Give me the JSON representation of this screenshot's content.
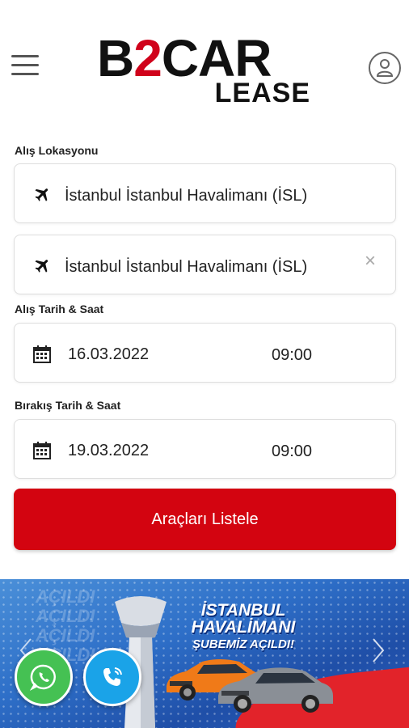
{
  "header": {
    "logo_main_left": "B",
    "logo_main_two": "2",
    "logo_main_right": "CAR",
    "logo_sub": "LEASE",
    "menu_icon": "hamburger-menu-icon",
    "user_icon": "user-account-icon"
  },
  "pickup": {
    "label": "Alış Lokasyonu",
    "location": "İstanbul İstanbul Havalimanı (İSL)",
    "icon": "plane-icon"
  },
  "dropoff": {
    "location": "İstanbul İstanbul Havalimanı (İSL)",
    "clear": "×",
    "icon": "plane-icon"
  },
  "pickup_datetime": {
    "label": "Alış Tarih & Saat",
    "date": "16.03.2022",
    "time": "09:00",
    "icon": "calendar-icon"
  },
  "return_datetime": {
    "label": "Bırakış Tarih & Saat",
    "date": "19.03.2022",
    "time": "09:00",
    "icon": "calendar-icon"
  },
  "submit_label": "Araçları Listele",
  "banner": {
    "ghost_text": [
      "AÇILDI",
      "AÇILDI",
      "AÇILDI",
      "AÇILDI"
    ],
    "title_line1": "İSTANBUL",
    "title_line2": "HAVALİMANI",
    "title_line3": "ŞUBEMİZ AÇILDI!"
  },
  "colors": {
    "accent_red": "#d30410",
    "whatsapp_green": "#45c153",
    "call_blue": "#1aa3e8"
  }
}
